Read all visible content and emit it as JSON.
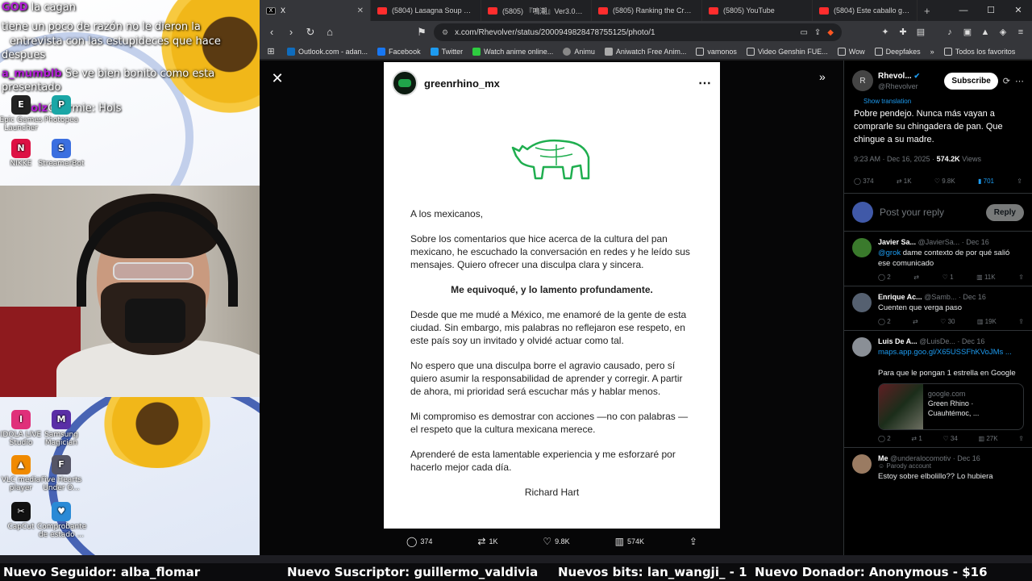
{
  "desktop": {
    "chat": [
      {
        "user": "GOD",
        "text": "la cagan"
      },
      {
        "user": "",
        "text": "tiene un poco de razón no le dieron la"
      },
      {
        "user": "",
        "text": "entrevista con las estupideces que hace"
      },
      {
        "user": "",
        "text": "despues"
      },
      {
        "user": "a_mumblb",
        "text": "Se ve bien bonito como esta"
      },
      {
        "user": "",
        "text": "presentado"
      },
      {
        "user": "Idolz",
        "text": "Charmie: Hols"
      }
    ],
    "icons": [
      {
        "label": "Epic Games Launcher",
        "color": "#222"
      },
      {
        "label": "Photopea",
        "color": "#1aa6a6"
      },
      {
        "label": "NIKKE",
        "color": "#d14"
      },
      {
        "label": "StreamerBot",
        "color": "#3b6fe0"
      },
      {
        "label": "IDOLA LIVE Studio",
        "color": "#e0307a"
      },
      {
        "label": "Samsung Magician",
        "color": "#5a2ea6"
      },
      {
        "label": "VLC media player",
        "color": "#f08a00"
      },
      {
        "label": "Five Hearts Under O...",
        "color": "#556"
      },
      {
        "label": "CapCut",
        "color": "#111"
      },
      {
        "label": "Comprobante de estado ...",
        "color": "#2a8ad6"
      }
    ]
  },
  "browser": {
    "tabs": [
      {
        "title": "X",
        "active": true
      },
      {
        "title": "(5804) Lasagna Soup @Lion"
      },
      {
        "title": "(5805) 『鳴潮』Ver3.0PV | 星"
      },
      {
        "title": "(5805) Ranking the Craziest"
      },
      {
        "title": "(5805) YouTube"
      },
      {
        "title": "(5804) Este caballo gano la t"
      }
    ],
    "url": "x.com/Rhevolver/status/2000949828478755125/photo/1",
    "bookmarks": [
      {
        "label": "Outlook.com - adan...",
        "color": "#0f6cbd"
      },
      {
        "label": "Facebook",
        "color": "#1877f2"
      },
      {
        "label": "Twitter",
        "color": "#1d9bf0"
      },
      {
        "label": "Watch anime online...",
        "color": "#2ecc40"
      },
      {
        "label": "Animu",
        "color": "#888"
      },
      {
        "label": "Aniwatch Free Anim...",
        "color": "#aaa"
      },
      {
        "label": "vamonos",
        "color": "#999"
      },
      {
        "label": "Video Genshin FUE...",
        "color": "#999"
      },
      {
        "label": "Wow",
        "color": "#999"
      },
      {
        "label": "Deepfakes",
        "color": "#999"
      },
      {
        "label": "Todos los favoritos",
        "color": "#999"
      }
    ]
  },
  "post": {
    "username": "greenrhino_mx",
    "letter": {
      "greeting": "A los mexicanos,",
      "p1": "Sobre los comentarios que hice acerca de la cultura del pan mexicano, he escuchado la conversación en redes y he leído sus mensajes. Quiero ofrecer una disculpa clara y sincera.",
      "bold": "Me equivoqué, y lo lamento profundamente.",
      "p2": "Desde que me mudé a México, me enamoré de la gente de esta ciudad. Sin embargo, mis palabras no reflejaron ese respeto, en este país soy un invitado y olvidé actuar como tal.",
      "p3": "No espero que una disculpa borre el agravio causado, pero sí quiero asumir la responsabilidad de aprender y corregir. A partir de ahora, mi prioridad será escuchar más y hablar menos.",
      "p4": "Mi compromiso es demostrar con acciones —no con palabras — el respeto que la cultura mexicana merece.",
      "p5": "Aprenderé de esta lamentable experiencia y me esforzaré por hacerlo mejor cada día.",
      "signature": "Richard Hart"
    },
    "stats": {
      "replies": "374",
      "reposts": "1K",
      "likes": "9.8K",
      "views": "574K"
    }
  },
  "side": {
    "name": "Rhevol...",
    "handle": "@Rhevolver",
    "subscribe": "Subscribe",
    "show_translation": "Show translation",
    "text": "Pobre pendejo. Nunca más vayan a comprarle su chingadera de pan. Que chingue a su madre.",
    "time": "9:23 AM · Dec 16, 2025 ·",
    "views_count": "574.2K",
    "views_label": "Views",
    "actions": {
      "replies": "374",
      "reposts": "1K",
      "likes": "9.8K",
      "bookmarks": "701"
    },
    "reply_placeholder": "Post your reply",
    "reply_button": "Reply",
    "comments": [
      {
        "name": "Javier Sa...",
        "handle": "@JavierSa...",
        "date": "· Dec 16",
        "mention": "@grok",
        "text": "dame contexto de por qué salió ese comunicado",
        "stats": [
          "2",
          "",
          "1",
          "11K"
        ],
        "avatar": "#3a7a2c"
      },
      {
        "name": "Enrique Ac...",
        "handle": "@Samb...",
        "date": "· Dec 16",
        "mention": "",
        "text": "Cuenten que verga paso",
        "stats": [
          "2",
          "",
          "30",
          "19K"
        ],
        "avatar": "#556070"
      },
      {
        "name": "Luis De A...",
        "handle": "@LuisDe...",
        "date": "· Dec 16",
        "mention": "maps.app.goo.gl/X65USSFhKVoJMs ...",
        "text": "Para que le pongan 1 estrella en Google",
        "stats": [
          "2",
          "1",
          "34",
          "27K"
        ],
        "avatar": "#8a8f96",
        "card": {
          "domain": "google.com",
          "title": "Green Rhino · Cuauhtémoc, ..."
        }
      },
      {
        "name": "Me",
        "handle": "@underalocomotiv",
        "date": "· Dec 16",
        "mention": "",
        "parody": "Parody account",
        "text": "Estoy sobre elbolillo?? Lo hubiera",
        "stats": [],
        "avatar": "#9a7b62"
      }
    ]
  },
  "ticker": {
    "items": [
      "Nuevo Seguidor: alba_flomar",
      "Nuevo Suscriptor: guillermo_valdivia",
      "Nuevos bits: lan_wangji_ - 1",
      "Nuevo Donador: Anonymous - $16"
    ]
  }
}
